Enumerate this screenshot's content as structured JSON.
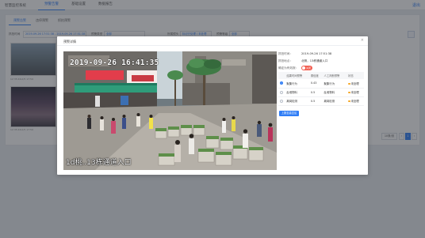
{
  "app": {
    "title": "智慧监控系统",
    "nav": [
      "预警告警",
      "基础设置",
      "数据报告"
    ],
    "logout": "退出"
  },
  "background": {
    "subtabs": [
      "预警告警",
      "违停预警",
      "抓拍预警"
    ],
    "filters": [
      {
        "label": "抓拍时间",
        "value": "2019-09-26 17:51:38 - 2019-09-26 17:51:38"
      },
      {
        "label": "预警类型",
        "value": "全部"
      },
      {
        "label": "所属镜头",
        "value": "标记已处理 / 未处理"
      },
      {
        "label": "预警等级",
        "value": "全部"
      }
    ],
    "thumb_captions": [
      "12:35:46.0/5 17:59",
      "12:35:46.0/5 17:59"
    ],
    "pager": {
      "page_size": "10条/页",
      "current": "1"
    }
  },
  "modal": {
    "title": "预警详情",
    "close": "×",
    "photo": {
      "timestamp": "2019-09-26 16:41:35",
      "camera_label": "1d桃..13栋通道入口"
    },
    "info": [
      {
        "label": "抓拍时间：",
        "value": "2019-09-26 17:51:38"
      },
      {
        "label": "抓拍地点：",
        "value": "北侧，13栋通道入口"
      },
      {
        "label": "确定为有效报：",
        "value": "",
        "switch": "关闭"
      }
    ],
    "table": {
      "headers": [
        "",
        "结果时间预警",
        "置信度",
        "人工判断预警",
        "状态"
      ],
      "rows": [
        {
          "selected": true,
          "type": "聚集行为",
          "confidence": "0.43",
          "manual": "聚集行为",
          "status": "未处理"
        },
        {
          "selected": false,
          "type": "乱堆物料",
          "confidence": "0.5",
          "manual": "乱堆物料",
          "status": "未处理"
        },
        {
          "selected": false,
          "type": "离岗检测",
          "confidence": "0.5",
          "manual": "离岗检测",
          "status": "未处理"
        }
      ]
    },
    "submit": "上报至高空区",
    "colors": {
      "accent": "#2f7df6",
      "switch_off": "#f25b4e",
      "status": "#f5a623"
    }
  }
}
